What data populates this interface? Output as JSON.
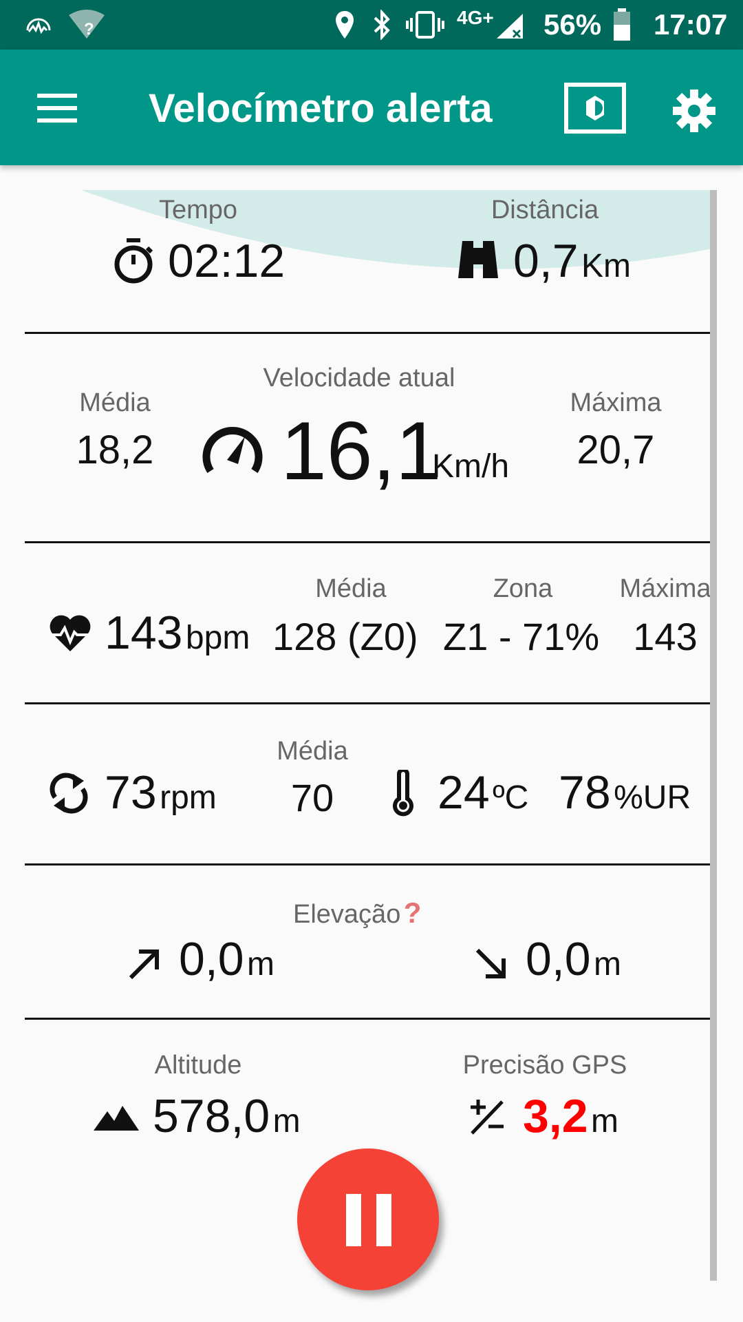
{
  "status_bar": {
    "network": "4G+",
    "battery": "56%",
    "time": "17:07"
  },
  "app_bar": {
    "title": "Velocímetro alerta",
    "icons": [
      "menu-icon",
      "brightness-icon",
      "settings-icon"
    ]
  },
  "time_distance": {
    "time_label": "Tempo",
    "time_value": "02:12",
    "distance_label": "Distância",
    "distance_value": "0,7",
    "distance_unit": "Km"
  },
  "speed": {
    "avg_label": "Média",
    "avg_value": "18,2",
    "current_label": "Velocidade atual",
    "current_value": "16,1",
    "current_unit": "Km/h",
    "max_label": "Máxima",
    "max_value": "20,7"
  },
  "heart": {
    "value": "143",
    "unit": "bpm",
    "avg_label": "Média",
    "avg_value": "128 (Z0)",
    "zone_label": "Zona",
    "zone_value": "Z1 - 71%",
    "max_label": "Máxima",
    "max_value": "143"
  },
  "cadence": {
    "value": "73",
    "unit": "rpm",
    "avg_label": "Média",
    "avg_value": "70",
    "temp_value": "24",
    "temp_unit": "ºC",
    "humidity_value": "78",
    "humidity_unit": "%UR"
  },
  "elevation": {
    "label": "Elevação",
    "help": "?",
    "up_value": "0,0",
    "up_unit": "m",
    "down_value": "0,0",
    "down_unit": "m"
  },
  "altitude": {
    "label": "Altitude",
    "value": "578,0",
    "unit": "m",
    "gps_label": "Precisão GPS",
    "gps_value": "3,2",
    "gps_unit": "m"
  },
  "colors": {
    "primary": "#009688",
    "primary_dark": "#00695c",
    "fab": "#f44336",
    "warning_text": "#ff0000"
  }
}
